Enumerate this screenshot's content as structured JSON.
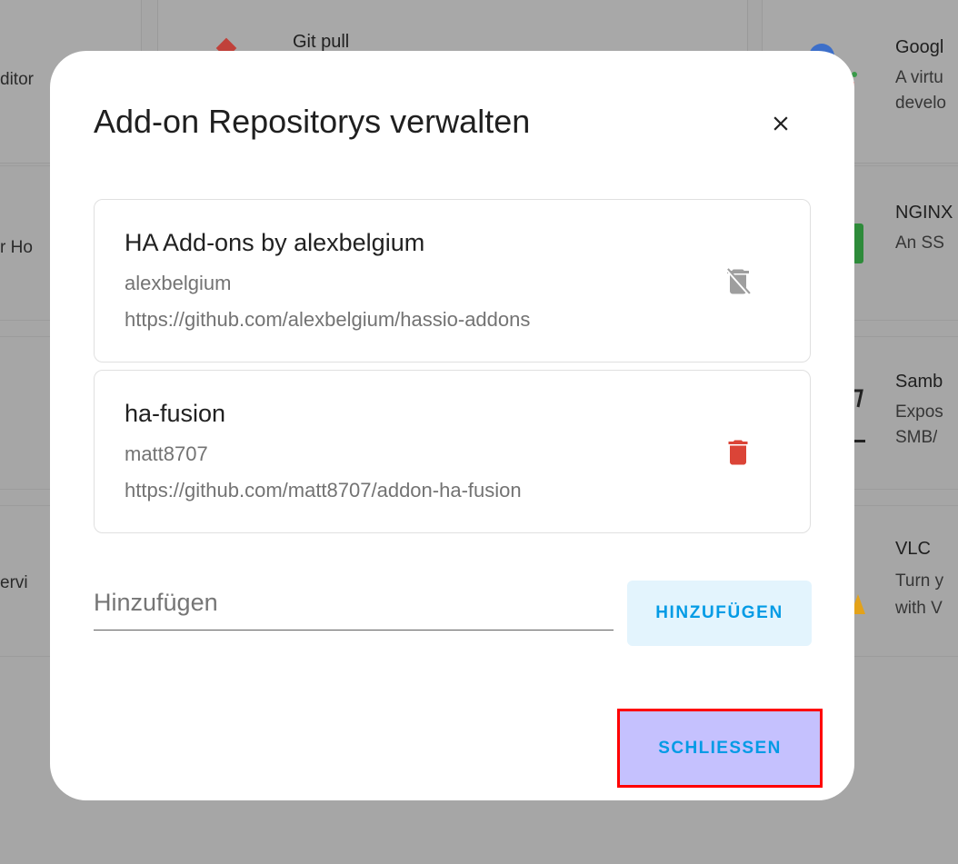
{
  "background": {
    "cards": [
      {
        "title": "Git pull",
        "subtitle": ""
      },
      {
        "title": "Googl",
        "subtitle_lines": [
          "A virtu",
          "develo"
        ]
      },
      {
        "title": "NGINX",
        "subtitle_lines": [
          "An SS"
        ]
      },
      {
        "title": "Samb",
        "subtitle_lines": [
          "Expos",
          "SMB/"
        ]
      },
      {
        "title": "VLC",
        "subtitle_lines": [
          "Turn y",
          "with V"
        ]
      }
    ],
    "left_fragments": [
      "ditor",
      "r Ho",
      "ervi"
    ]
  },
  "dialog": {
    "title": "Add-on Repositorys verwalten",
    "close_icon": "close-icon",
    "repositories": [
      {
        "name": "HA Add-ons by alexbelgium",
        "maintainer": "alexbelgium",
        "url": "https://github.com/alexbelgium/hassio-addons",
        "delete_enabled": false
      },
      {
        "name": "ha-fusion",
        "maintainer": "matt8707",
        "url": "https://github.com/matt8707/addon-ha-fusion",
        "delete_enabled": true
      }
    ],
    "add_input": {
      "placeholder": "Hinzufügen",
      "value": ""
    },
    "add_button_label": "HINZUFÜGEN",
    "close_button_label": "SCHLIESSEN"
  },
  "colors": {
    "accent": "#039be5",
    "delete_active": "#db4437",
    "delete_disabled": "#9e9e9e",
    "overlay": "#a6a6a6",
    "highlight_border": "#ff0000",
    "highlight_fill": "#c5c1fe"
  }
}
